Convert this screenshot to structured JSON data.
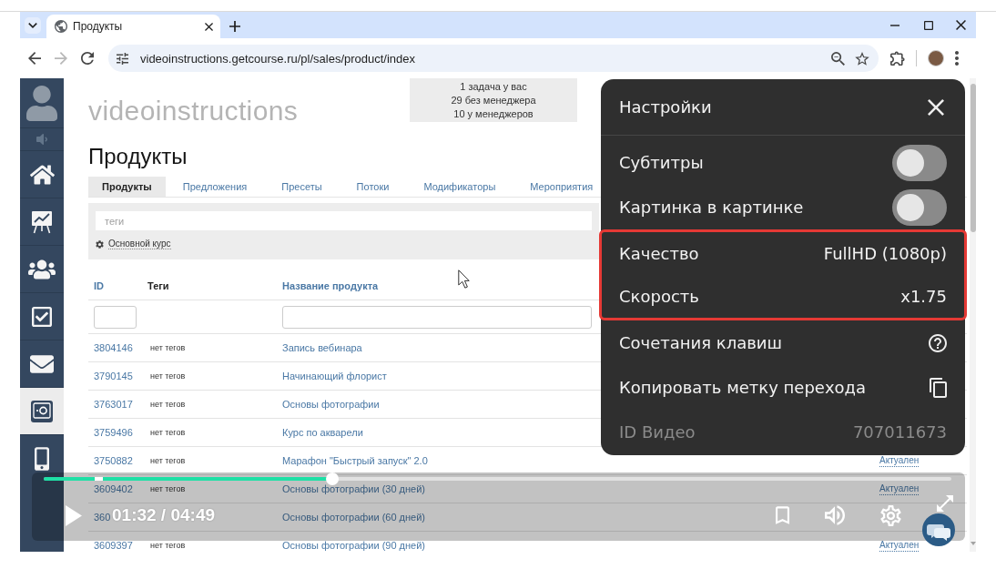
{
  "browser": {
    "tabs": [
      {
        "title": "Продукты",
        "selected": true
      }
    ],
    "nav": [
      {
        "kind": "back",
        "disabled": false
      },
      {
        "kind": "forward",
        "disabled": true
      },
      {
        "kind": "reload",
        "disabled": false
      }
    ],
    "url": "videoinstructions.getcourse.ru/pl/sales/product/index"
  },
  "sidebar": {
    "items": [
      {
        "selected": false
      },
      {
        "selected": false
      },
      {
        "selected": false
      },
      {
        "selected": false
      },
      {
        "selected": false
      },
      {
        "selected": true
      },
      {
        "selected": false
      }
    ]
  },
  "page": {
    "logo": "videoinstructions",
    "notices": [
      "1 задача у вас",
      "29 без менеджера",
      "10 у менеджеров"
    ],
    "title": "Продукты",
    "tabs": [
      {
        "label": "Продукты",
        "selected": true
      },
      {
        "label": "Предложения",
        "selected": false
      },
      {
        "label": "Пресеты",
        "selected": false
      },
      {
        "label": "Потоки",
        "selected": false
      },
      {
        "label": "Модификаторы",
        "selected": false
      },
      {
        "label": "Мероприятия",
        "selected": false
      }
    ],
    "filter": {
      "placeholder": "теги",
      "tag": "Основной курс"
    },
    "table": {
      "columns": [
        {
          "label": "ID",
          "sortable": true
        },
        {
          "label": "Теги",
          "sortable": false
        },
        {
          "label": "Название продукта",
          "sortable": true
        }
      ],
      "rows": [
        {
          "id": "3804146",
          "tags": "нет тегов",
          "name": "Запись вебинара"
        },
        {
          "id": "3790145",
          "tags": "нет тегов",
          "name": "Начинающий флорист"
        },
        {
          "id": "3763017",
          "tags": "нет тегов",
          "name": "Основы фотографии"
        },
        {
          "id": "3759496",
          "tags": "нет тегов",
          "name": "Курс по акварели"
        },
        {
          "id": "3750882",
          "tags": "нет тегов",
          "name": "Марафон \"Быстрый запуск\" 2.0",
          "status": "Актуален"
        },
        {
          "id": "3609402",
          "tags": "нет тегов",
          "name": "Основы фотографии (30 дней)",
          "status": "Актуален"
        },
        {
          "id": "360",
          "name": "Основы фотографии (60 дней)"
        },
        {
          "id": "3609397",
          "tags": "нет тегов",
          "name": "Основы фотографии (90 дней)",
          "status": "Актуален"
        }
      ]
    }
  },
  "settings": {
    "title": "Настройки",
    "items": [
      {
        "kind": "toggle",
        "label": "Субтитры",
        "on": false,
        "highlighted": false
      },
      {
        "kind": "toggle",
        "label": "Картинка в картинке",
        "on": false,
        "highlighted": false
      },
      {
        "kind": "value",
        "label": "Качество",
        "value": "FullHD (1080p)",
        "highlighted": true
      },
      {
        "kind": "value",
        "label": "Скорость",
        "value": "x1.75",
        "highlighted": true
      },
      {
        "kind": "help",
        "label": "Сочетания клавиш",
        "highlighted": false
      },
      {
        "kind": "copy",
        "label": "Копировать метку перехода",
        "highlighted": false
      },
      {
        "kind": "info",
        "label": "ID Видео",
        "value": "707011673",
        "highlighted": false
      }
    ]
  },
  "player": {
    "playing": false,
    "level": 0.318,
    "time": "01:32 / 04:49"
  }
}
